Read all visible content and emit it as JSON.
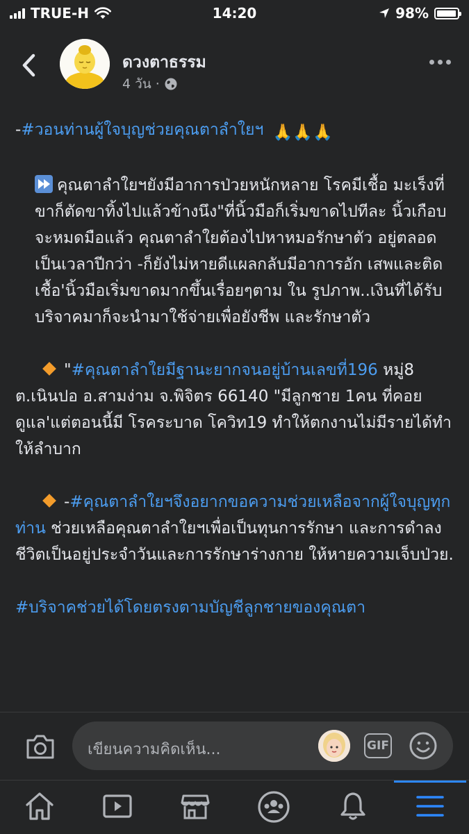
{
  "status_bar": {
    "carrier": "TRUE-H",
    "time": "14:20",
    "battery": "98%",
    "battery_level": 0.98
  },
  "post": {
    "page_name": "ดวงตาธรรม",
    "time_ago": "4 วัน",
    "separator": "·",
    "body": {
      "p1_prefix": "-",
      "p1_link": "#วอนท่านผู้ใจบุญช่วยคุณตาลำใยฯ",
      "p1_emoji": "🙏🙏🙏",
      "p2": "คุณตาลำใยฯยังมีอาการป่วยหนักหลาย โรคมีเชื้อ มะเร็งที่ขาก็ตัดขาทิ้งไปแล้วข้างนึง\"ที่นิ้วมือก็เริ่มขาดไปทีละ นิ้วเกือบจะหมดมือแล้ว คุณตาลำใยต้องไปหาหมอรักษาตัว อยู่ตลอดเป็นเวลาปีกว่า -ก็ยังไม่หายดีแผลกลับมีอาการอัก เสพและติดเชื้อ'นิ้วมือเริ่มขาดมากขึ้นเรื่อยๆตาม ใน รูปภาพ..เงินที่ได้รับบริจาคมาก็จะนำมาใช้จ่ายเพื่อยังชีพ และรักษาตัว",
      "p3_quote": "\"",
      "p3_link": "#คุณตาลำใยมีฐานะยากจนอยู่บ้านเลขที่196",
      "p3_rest": "หมู่8 ต.เนินปอ อ.สามง่าม จ.พิจิตร 66140 \"มีลูกชาย 1คน ที่คอยดูแล'แต่ตอนนี้มี โรคระบาด โควิท19 ทำให้ตกงานไม่มีรายได้ทำ ให้ลำบาก",
      "p4_prefix": "-",
      "p4_link": "#คุณตาลำใยฯจึงอยากขอความช่วยเหลือจากผู้ใจบุญทุกท่าน",
      "p4_rest": " ช่วยเหลือคุณตาลำใยฯเพื่อเป็นทุนการรักษา และการดำลงชีวิตเป็นอยู่ประจำวันและการรักษาร่างกาย ให้หายความเจ็บป่วย.",
      "p5_link": "#บริจาคช่วยได้โดยตรงตามบัญชีลูกชายของคุณตา"
    }
  },
  "comment_bar": {
    "placeholder": "เขียนความคิดเห็น...",
    "gif_label": "GIF"
  },
  "icons": {
    "back": "chevron-left-icon",
    "more": "more-horizontal-icon",
    "globe": "globe-icon",
    "camera": "camera-icon",
    "emoji": "smiley-icon",
    "tabs": [
      "home-icon",
      "watch-icon",
      "marketplace-icon",
      "groups-icon",
      "bell-icon",
      "menu-icon"
    ]
  },
  "colors": {
    "background": "#242526",
    "link": "#4c9df0",
    "text": "#e4e6eb",
    "active_tab": "#2d88ff"
  }
}
